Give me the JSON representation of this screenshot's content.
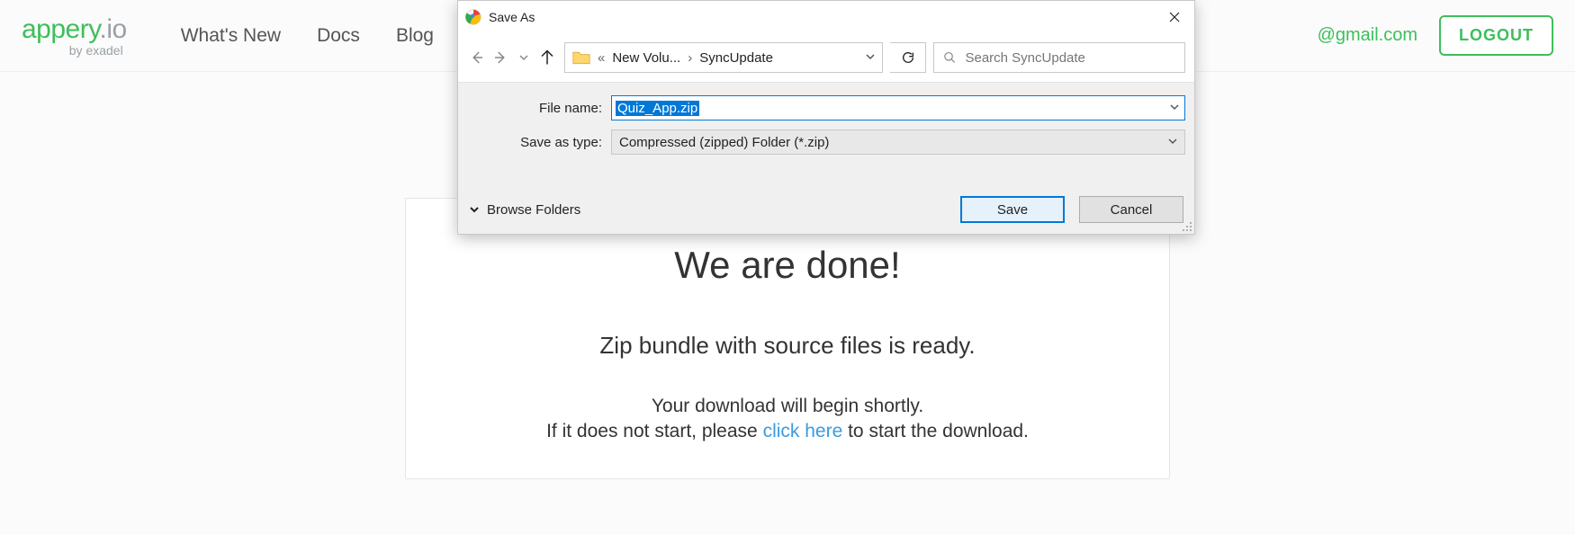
{
  "header": {
    "logo_green": "appery",
    "logo_grey": ".io",
    "byline": "by exadel",
    "nav": [
      "What's New",
      "Docs",
      "Blog"
    ],
    "email": "@gmail.com",
    "logout": "LOGOUT"
  },
  "card": {
    "title": "We are done!",
    "ready": "Zip bundle with source files is ready.",
    "shortly": "Your download will begin shortly.",
    "line_pre": "If it does not start, please ",
    "line_link": "click here",
    "line_post": " to start the download."
  },
  "dialog": {
    "title": "Save As",
    "breadcrumb": {
      "truncated": "«",
      "vol": "New Volu...",
      "folder": "SyncUpdate"
    },
    "search_placeholder": "Search SyncUpdate",
    "filename_label": "File name:",
    "filename_value": "Quiz_App.zip",
    "type_label": "Save as type:",
    "type_value": "Compressed (zipped) Folder (*.zip)",
    "browse": "Browse Folders",
    "save": "Save",
    "cancel": "Cancel"
  }
}
